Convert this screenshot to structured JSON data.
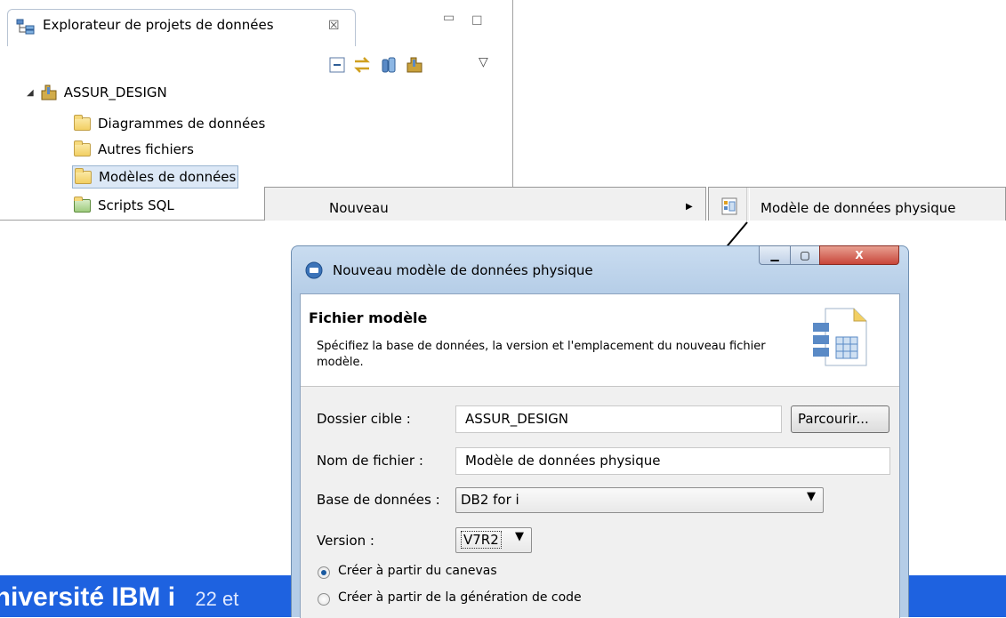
{
  "explorer": {
    "tab_title": "Explorateur de projets de données",
    "close_symbol": "☒",
    "minimize_symbol": "▭",
    "maximize_symbol": "☐",
    "menu_arrow": "▽",
    "project": {
      "name": "ASSUR_DESIGN",
      "expand_symbol": "◢",
      "children": [
        {
          "label": "Diagrammes de données",
          "icon": "folder-icon"
        },
        {
          "label": "Autres fichiers",
          "icon": "folder-icon"
        },
        {
          "label": "Modèles de données",
          "icon": "data-models-folder-icon"
        },
        {
          "label": "Scripts SQL",
          "icon": "sql-scripts-folder-icon"
        }
      ]
    }
  },
  "context_menu": {
    "new_label": "Nouveau",
    "submenu_arrow": "▶",
    "submenu_item": "Modèle de données physique"
  },
  "dialog": {
    "title": "Nouveau modèle de données physique",
    "header_title": "Fichier modèle",
    "header_description": "Spécifiez la base de données, la version et l'emplacement du nouveau fichier modèle.",
    "target_folder": {
      "label": "Dossier cible :",
      "value": "ASSUR_DESIGN",
      "button": "Parcourir..."
    },
    "file_name": {
      "label": "Nom de fichier :",
      "value": "Modèle de données physique"
    },
    "database": {
      "label": "Base de données :",
      "value": "DB2 for i"
    },
    "version": {
      "label": "Version :",
      "value": "V7R2"
    },
    "combo_arrow": "▼",
    "options": [
      {
        "label": "Créer à partir du canevas",
        "selected": true
      },
      {
        "label": "Créer à partir de la génération de code",
        "selected": false
      }
    ],
    "win_controls": {
      "minimize": "▁",
      "maximize": "▢",
      "close": "X"
    }
  },
  "footer": {
    "org_text": "Université IBM i",
    "date_fragment": "22 et"
  },
  "colors": {
    "footer_band": "#1e62e0",
    "close_button": "#c8463a",
    "dialog_frame": "#b5cde7"
  }
}
